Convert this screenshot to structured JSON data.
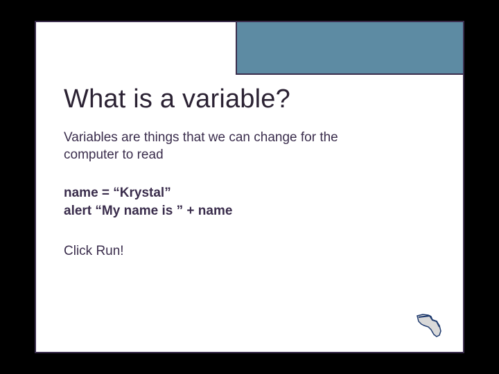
{
  "slide": {
    "title": "What is a variable?",
    "description": "Variables are things that we can change for the computer to read",
    "code_line1": "name = “Krystal”",
    "code_line2": "alert “My name is ” + name",
    "cta": "Click Run!"
  }
}
